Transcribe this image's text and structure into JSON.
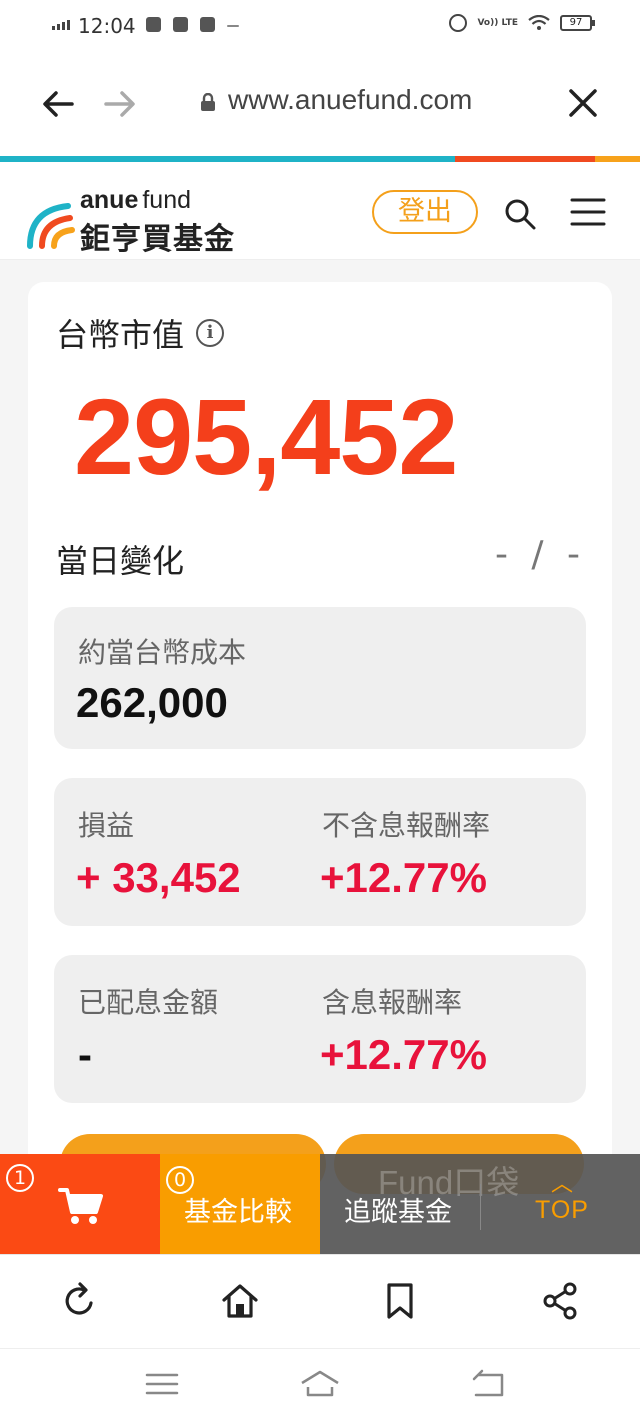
{
  "status_bar": {
    "time": "12:04",
    "volte": "Vo)) LTE",
    "battery": "97"
  },
  "browser": {
    "url": "www.anuefund.com"
  },
  "site": {
    "logo_en_1": "anue",
    "logo_en_2": "fund",
    "logo_zh": "鉅亨買基金",
    "logout": "登出"
  },
  "summary": {
    "market_value_label": "台幣市值",
    "info_glyph": "i",
    "market_value": "295,452",
    "daily_change_label": "當日變化",
    "daily_change_value": "- / -",
    "cost_label": "約當台幣成本",
    "cost_value": "262,000",
    "pnl_label": "損益",
    "pnl_value": "+ 33,452",
    "return_ex_div_label": "不含息報酬率",
    "return_ex_div_value": "+12.77%",
    "dividend_label": "已配息金額",
    "dividend_value": "-",
    "return_inc_div_label": "含息報酬率",
    "return_inc_div_value": "+12.77%"
  },
  "float_bar": {
    "cart_count": "1",
    "compare_count": "0",
    "compare_label": "基金比較",
    "track_label": "追蹤基金",
    "ghost_label": "Fund口袋",
    "top_label": "TOP"
  },
  "colors": {
    "accent_orange": "#f99d00",
    "value_red": "#f43f1b",
    "gain_red": "#e8123b",
    "cart_bg": "#fb4a14"
  }
}
